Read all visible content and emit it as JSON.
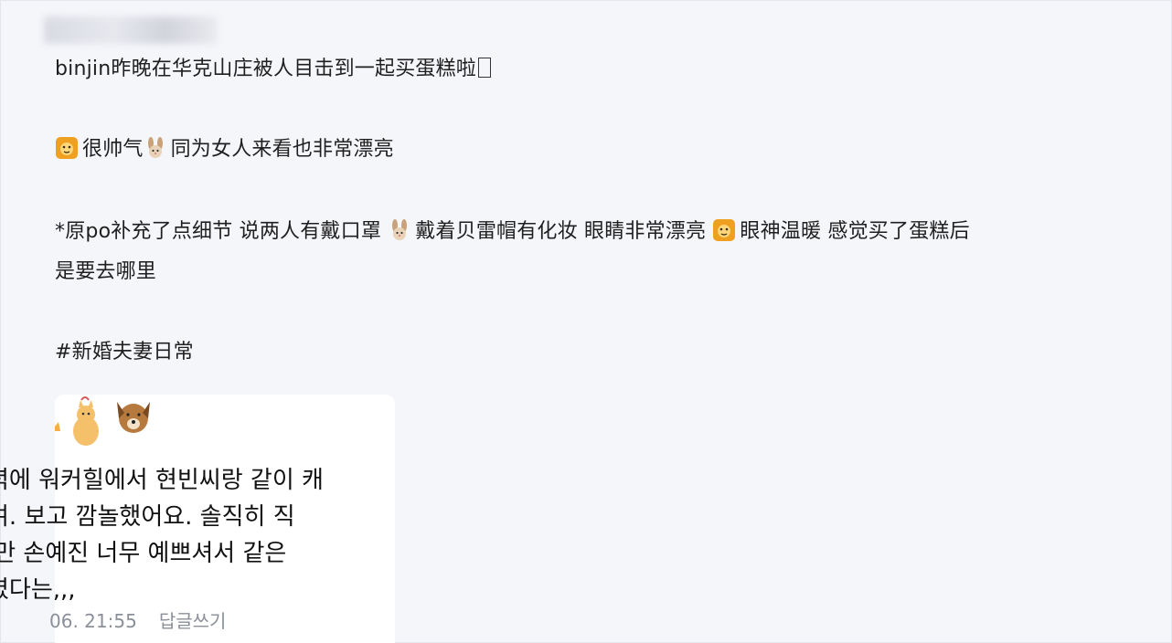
{
  "post": {
    "line1": "binjin昨晚在华克山庄被人目击到一起买蛋糕啦",
    "line2_a": "很帅气",
    "line2_b": "同为女人来看也非常漂亮",
    "line3_a": "*原po补充了点细节 说两人有戴口罩 ",
    "line3_b": "戴着贝雷帽有化妆 眼睛非常漂亮 ",
    "line3_c": "眼神温暖 感觉买了蛋糕后",
    "line4": "是要去哪里",
    "hashtag": "#新婚夫妻日常"
  },
  "comment": {
    "line1": "녁에 워커힐에서 현빈씨랑 같이 캐",
    "line2": "여. 보고 깜놀했어요. 솔직히 직",
    "line3": "l만 손예진 너무 예쁘셔서 같은",
    "line4": "였다는,,,",
    "time": "06. 21:55",
    "reply_label": "답글쓰기"
  },
  "icons": [
    "lion-icon",
    "rabbit-icon",
    "cat-sticker-icon",
    "dog-sticker-icon"
  ],
  "colors": {
    "background": "#f5f6fa",
    "card": "#ffffff",
    "meta": "#8a8f99",
    "lion": "#f0a020",
    "rabbit": "#caa27a"
  }
}
